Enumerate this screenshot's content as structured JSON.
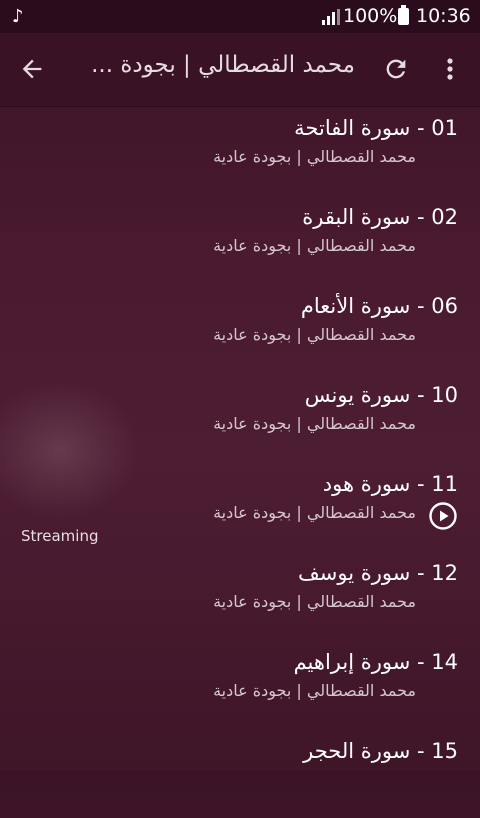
{
  "status_bar": {
    "battery": "100%",
    "time": "10:36",
    "icons": [
      "music-note-icon",
      "signal-icon",
      "battery-icon"
    ]
  },
  "app_bar": {
    "title": "محمد القصطالي | بجودة ...",
    "icons": [
      "back-arrow-icon",
      "refresh-icon",
      "more-vert-icon"
    ]
  },
  "tracks": [
    {
      "title": "01 - سورة الفاتحة",
      "subtitle": "محمد القصطالي | بجودة عادية"
    },
    {
      "title": "02 - سورة البقرة",
      "subtitle": "محمد القصطالي | بجودة عادية"
    },
    {
      "title": "06 - سورة الأنعام",
      "subtitle": "محمد القصطالي | بجودة عادية"
    },
    {
      "title": "10 - سورة يونس",
      "subtitle": "محمد القصطالي | بجودة عادية"
    },
    {
      "title": "11 - سورة هود",
      "subtitle": "محمد القصطالي | بجودة عادية"
    },
    {
      "title": "12 - سورة يوسف",
      "subtitle": "محمد القصطالي | بجودة عادية"
    },
    {
      "title": "14 - سورة إبراهيم",
      "subtitle": "محمد القصطالي | بجودة عادية"
    },
    {
      "title": "15 - سورة الحجر",
      "subtitle": ""
    }
  ],
  "streaming_label": "Streaming",
  "colors": {
    "background": "#4a1a30",
    "app_bar": "#3a1226",
    "status_bar": "#2b0c1c"
  }
}
